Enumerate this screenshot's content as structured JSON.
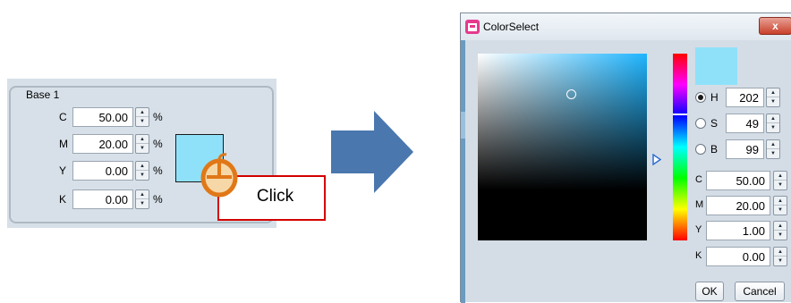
{
  "left_panel": {
    "group_title": "Base 1",
    "rows": [
      {
        "label": "C",
        "value": "50.00",
        "unit": "%"
      },
      {
        "label": "M",
        "value": "20.00",
        "unit": "%"
      },
      {
        "label": "Y",
        "value": "0.00",
        "unit": "%"
      },
      {
        "label": "K",
        "value": "0.00",
        "unit": "%"
      }
    ],
    "swatch_color": "#8fe1fa"
  },
  "callout": {
    "text": "Click",
    "border_color": "#d40000"
  },
  "arrow_color": "#4a77ae",
  "dialog": {
    "title": "ColorSelect",
    "close_label": "x",
    "preview_color": "#8fe1fa",
    "hsb": [
      {
        "label": "H",
        "value": "202",
        "selected": true
      },
      {
        "label": "S",
        "value": "49",
        "selected": false
      },
      {
        "label": "B",
        "value": "99",
        "selected": false
      }
    ],
    "cmyk": [
      {
        "label": "C",
        "value": "50.00"
      },
      {
        "label": "M",
        "value": "20.00"
      },
      {
        "label": "Y",
        "value": "1.00"
      },
      {
        "label": "K",
        "value": "0.00"
      }
    ],
    "ok_label": "OK",
    "cancel_label": "Cancel"
  }
}
